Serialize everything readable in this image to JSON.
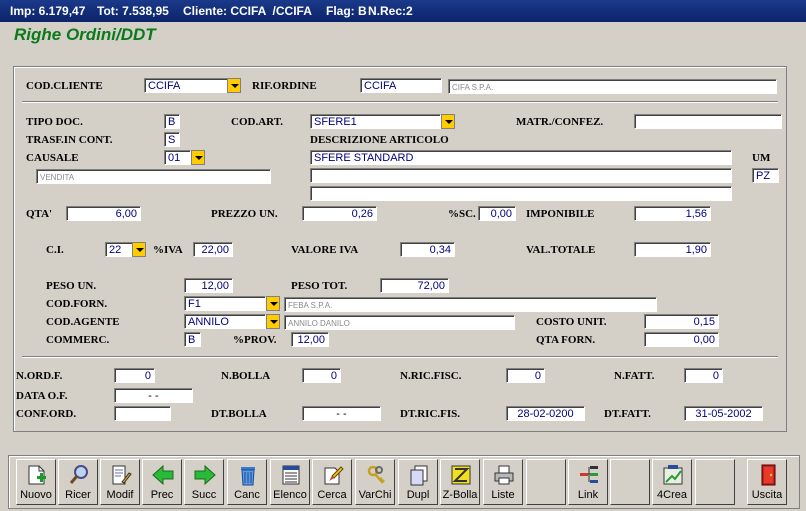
{
  "titlebar": {
    "imp": "Imp: 6.179,47",
    "tot": "Tot: 7.538,95",
    "cliente": "Cliente: CCIFA  /CCIFA",
    "flag": "Flag: B",
    "nrec": "N.Rec:2"
  },
  "heading": "Righe Ordini/DDT",
  "labels": {
    "cod_cliente": "COD.CLIENTE",
    "rif_ordine": "RIF.ORDINE",
    "tipo_doc": "TIPO DOC.",
    "cod_art": "COD.ART.",
    "matr_confez": "MATR./CONFEZ.",
    "trasf": "TRASF.IN CONT.",
    "descrizione": "DESCRIZIONE ARTICOLO",
    "causale": "CAUSALE",
    "um": "UM",
    "qta": "QTA'",
    "prezzo": "PREZZO UN.",
    "sc": "%SC.",
    "imponibile": "IMPONIBILE",
    "ci": "C.I.",
    "iva": "%IVA",
    "valore_iva": "VALORE IVA",
    "val_totale": "VAL.TOTALE",
    "peso_un": "PESO UN.",
    "peso_tot": "PESO TOT.",
    "cod_forn": "COD.FORN.",
    "cod_agente": "COD.AGENTE",
    "costo_unit": "COSTO UNIT.",
    "commerc": "COMMERC.",
    "prov": "%PROV.",
    "qta_forn": "QTA FORN.",
    "n_ord_f": "N.ORD.F.",
    "n_bolla": "N.BOLLA",
    "n_ric_fisc": "N.RIC.FISC.",
    "n_fatt": "N.FATT.",
    "data_of": "DATA O.F.",
    "conf_ord": "CONF.ORD.",
    "dt_bolla": "DT.BOLLA",
    "dt_ric_fis": "DT.RIC.FIS.",
    "dt_fatt": "DT.FATT."
  },
  "values": {
    "cod_cliente": "CCIFA",
    "rif_ordine": "CCIFA",
    "cliente_desc": "CIFA S.P.A.",
    "tipo_doc": "B",
    "cod_art": "SFERE1",
    "matr_confez": "",
    "trasf": "S",
    "causale": "01",
    "causale_desc": "VENDITA",
    "descr1": "SFERE STANDARD",
    "descr2": "",
    "descr3": "",
    "um": "PZ",
    "qta": "6,00",
    "prezzo": "0,26",
    "sc": "0,00",
    "imponibile": "1,56",
    "ci": "22",
    "iva": "22,00",
    "valore_iva": "0,34",
    "val_totale": "1,90",
    "peso_un": "12,00",
    "peso_tot": "72,00",
    "cod_forn": "F1",
    "forn_desc": "FEBA S.P.A.",
    "cod_agente": "ANNILO",
    "agente_desc": "ANNILO DANILO",
    "costo_unit": "0,15",
    "commerc": "B",
    "prov": "12,00",
    "qta_forn": "0,00",
    "n_ord_f": "0",
    "n_bolla": "0",
    "n_ric_fisc": "0",
    "n_fatt": "0",
    "data_of": "-   -",
    "conf_ord": "",
    "dt_bolla": "-   -",
    "dt_ric_fis": "28-02-0200",
    "dt_fatt": "31-05-2002"
  },
  "toolbar": {
    "nuovo": "Nuovo",
    "ricer": "Ricer",
    "modif": "Modif",
    "prec": "Prec",
    "succ": "Succ",
    "canc": "Canc",
    "elenco": "Elenco",
    "cerca": "Cerca",
    "varchi": "VarChi",
    "dupl": "Dupl",
    "zbolla": "Z-Bolla",
    "liste": "Liste",
    "link": "Link",
    "crea4": "4Crea",
    "uscita": "Uscita"
  },
  "icons": {
    "nuovo": "new-document-icon",
    "ricer": "search-magnifier-icon",
    "modif": "edit-document-icon",
    "prec": "arrow-left-icon",
    "succ": "arrow-right-icon",
    "canc": "trash-icon",
    "elenco": "list-icon",
    "cerca": "find-icon",
    "varchi": "keys-icon",
    "dupl": "duplicate-icon",
    "zbolla": "z-bolla-icon",
    "liste": "printer-icon",
    "link": "link-icon",
    "crea4": "create-icon",
    "uscita": "exit-door-icon"
  },
  "colors": {
    "title_bg": "#0b246a",
    "heading": "#0a7a1a",
    "field_text": "#000080",
    "dropdown": "#ffcc00",
    "window": "#d4d0c8"
  }
}
